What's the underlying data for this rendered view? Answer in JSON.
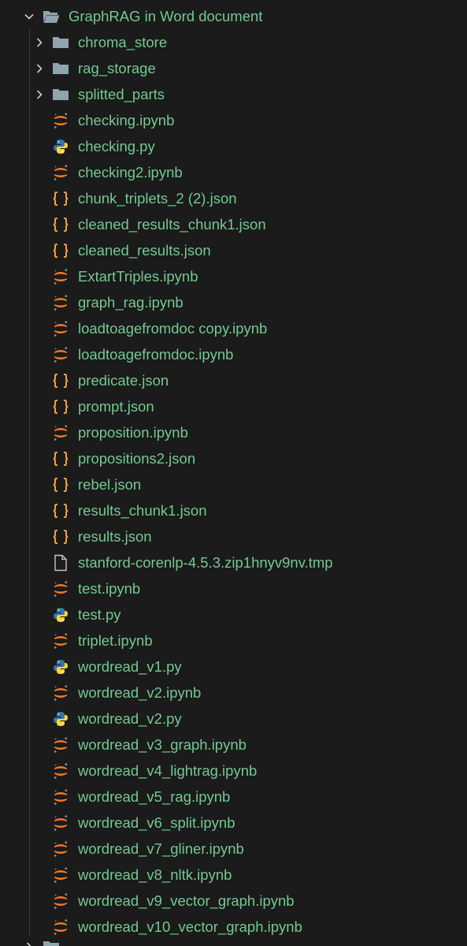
{
  "explorer": {
    "root": {
      "label": "GraphRAG in Word document",
      "expanded": true,
      "icon": "folder-open-icon"
    },
    "items": [
      {
        "type": "folder",
        "label": "chroma_store",
        "icon": "folder-icon",
        "expanded": false
      },
      {
        "type": "folder",
        "label": "rag_storage",
        "icon": "folder-icon",
        "expanded": false
      },
      {
        "type": "folder",
        "label": "splitted_parts",
        "icon": "folder-icon",
        "expanded": false
      },
      {
        "type": "notebook",
        "label": "checking.ipynb",
        "icon": "jupyter-icon"
      },
      {
        "type": "python",
        "label": "checking.py",
        "icon": "python-icon"
      },
      {
        "type": "notebook",
        "label": "checking2.ipynb",
        "icon": "jupyter-icon"
      },
      {
        "type": "json",
        "label": "chunk_triplets_2 (2).json",
        "icon": "json-icon"
      },
      {
        "type": "json",
        "label": "cleaned_results_chunk1.json",
        "icon": "json-icon"
      },
      {
        "type": "json",
        "label": "cleaned_results.json",
        "icon": "json-icon"
      },
      {
        "type": "notebook",
        "label": "ExtartTriples.ipynb",
        "icon": "jupyter-icon"
      },
      {
        "type": "notebook",
        "label": "graph_rag.ipynb",
        "icon": "jupyter-icon"
      },
      {
        "type": "notebook",
        "label": "loadtoagefromdoc copy.ipynb",
        "icon": "jupyter-icon"
      },
      {
        "type": "notebook",
        "label": "loadtoagefromdoc.ipynb",
        "icon": "jupyter-icon"
      },
      {
        "type": "json",
        "label": "predicate.json",
        "icon": "json-icon"
      },
      {
        "type": "json",
        "label": "prompt.json",
        "icon": "json-icon"
      },
      {
        "type": "notebook",
        "label": "proposition.ipynb",
        "icon": "jupyter-icon"
      },
      {
        "type": "json",
        "label": "propositions2.json",
        "icon": "json-icon"
      },
      {
        "type": "json",
        "label": "rebel.json",
        "icon": "json-icon"
      },
      {
        "type": "json",
        "label": "results_chunk1.json",
        "icon": "json-icon"
      },
      {
        "type": "json",
        "label": "results.json",
        "icon": "json-icon"
      },
      {
        "type": "file",
        "label": "stanford-corenlp-4.5.3.zip1hnyv9nv.tmp",
        "icon": "file-icon"
      },
      {
        "type": "notebook",
        "label": "test.ipynb",
        "icon": "jupyter-icon"
      },
      {
        "type": "python",
        "label": "test.py",
        "icon": "python-icon"
      },
      {
        "type": "notebook",
        "label": "triplet.ipynb",
        "icon": "jupyter-icon"
      },
      {
        "type": "python",
        "label": "wordread_v1.py",
        "icon": "python-icon"
      },
      {
        "type": "notebook",
        "label": "wordread_v2.ipynb",
        "icon": "jupyter-icon"
      },
      {
        "type": "python",
        "label": "wordread_v2.py",
        "icon": "python-icon"
      },
      {
        "type": "notebook",
        "label": "wordread_v3_graph.ipynb",
        "icon": "jupyter-icon"
      },
      {
        "type": "notebook",
        "label": "wordread_v4_lightrag.ipynb",
        "icon": "jupyter-icon"
      },
      {
        "type": "notebook",
        "label": "wordread_v5_rag.ipynb",
        "icon": "jupyter-icon"
      },
      {
        "type": "notebook",
        "label": "wordread_v6_split.ipynb",
        "icon": "jupyter-icon"
      },
      {
        "type": "notebook",
        "label": "wordread_v7_gliner.ipynb",
        "icon": "jupyter-icon"
      },
      {
        "type": "notebook",
        "label": "wordread_v8_nltk.ipynb",
        "icon": "jupyter-icon"
      },
      {
        "type": "notebook",
        "label": "wordread_v9_vector_graph.ipynb",
        "icon": "jupyter-icon"
      },
      {
        "type": "notebook",
        "label": "wordread_v10_vector_graph.ipynb",
        "icon": "jupyter-icon"
      }
    ],
    "next_root": {
      "label": "",
      "icon": "folder-icon",
      "expanded": false
    }
  },
  "colors": {
    "background": "#1b1b1b",
    "label": "#73c991",
    "folder": "#90a4ae",
    "chevron": "#cccccc",
    "jupyter": "#f37726",
    "python_blue": "#3776ab",
    "python_yellow": "#ffd43b",
    "json": "#f0a33a",
    "file": "#c5c5c5"
  }
}
